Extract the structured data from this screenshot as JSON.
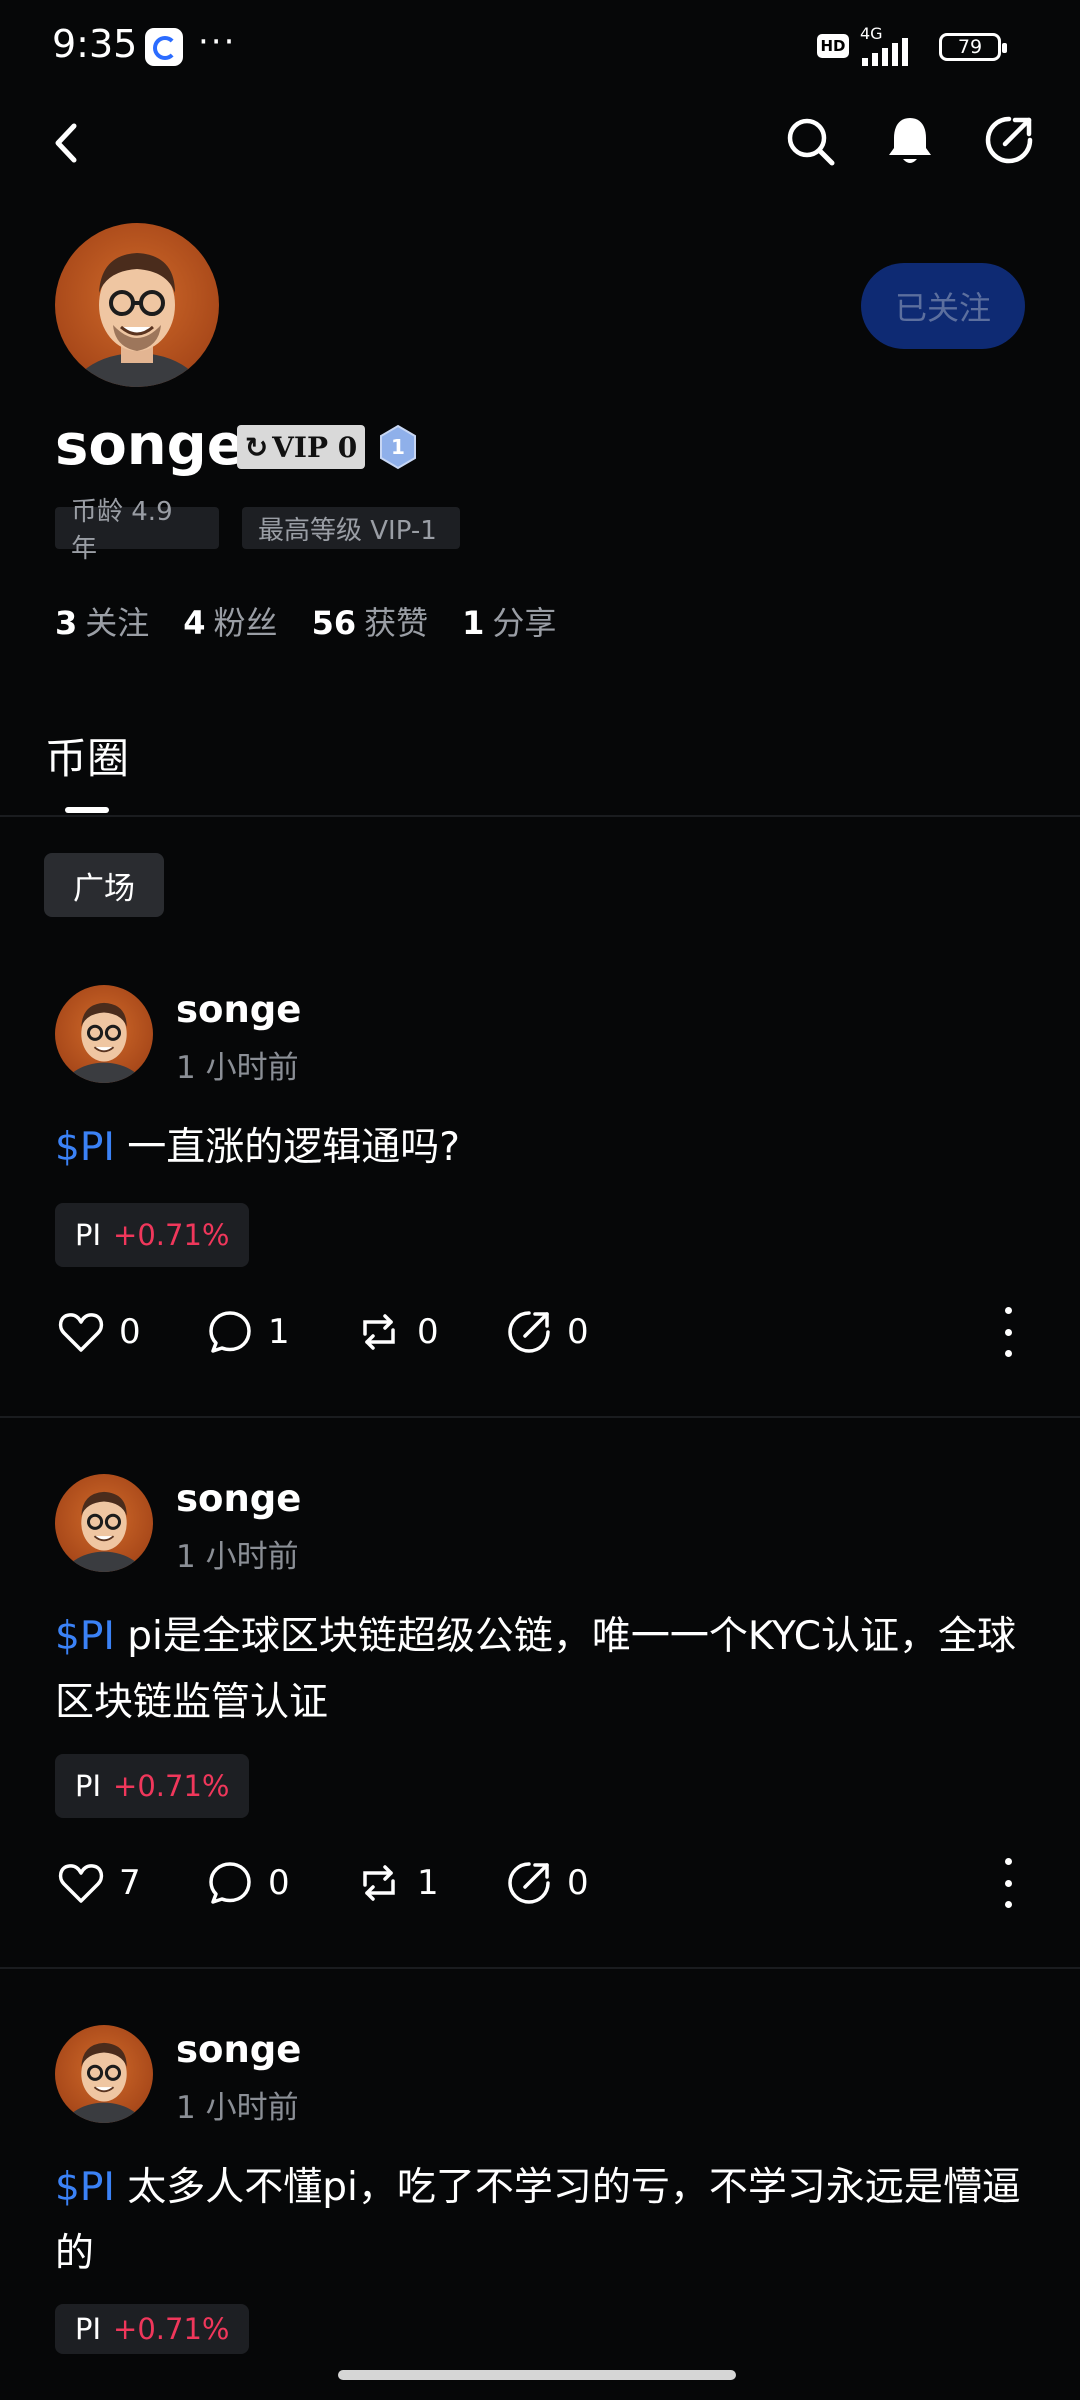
{
  "status": {
    "time": "9:35",
    "dots": "···",
    "hd": "HD",
    "network": "4G",
    "battery": "79"
  },
  "profile": {
    "username": "songe",
    "vip_label": "VIP 0",
    "level_badge": "1",
    "follow_button": "已关注",
    "tags": [
      "币龄 4.9 年",
      "最高等级 VIP-1"
    ],
    "stats": [
      {
        "num": "3",
        "label": "关注"
      },
      {
        "num": "4",
        "label": "粉丝"
      },
      {
        "num": "56",
        "label": "获赞"
      },
      {
        "num": "1",
        "label": "分享"
      }
    ]
  },
  "tab": {
    "label": "币圈"
  },
  "filter_chip": "广场",
  "posts": [
    {
      "author": "songe",
      "time": "1 小时前",
      "cashtag": "$PI",
      "text": " 一直涨的逻辑通吗?",
      "coin": "PI",
      "change": "+0.71%",
      "likes": "0",
      "comments": "1",
      "reposts": "0",
      "shares": "0"
    },
    {
      "author": "songe",
      "time": "1 小时前",
      "cashtag": "$PI",
      "text": " pi是全球区块链超级公链，唯一一个KYC认证，全球区块链监管认证",
      "coin": "PI",
      "change": "+0.71%",
      "likes": "7",
      "comments": "0",
      "reposts": "1",
      "shares": "0"
    },
    {
      "author": "songe",
      "time": "1 小时前",
      "cashtag": "$PI",
      "text": " 太多人不懂pi，吃了不学习的亏，不学习永远是懵逼的",
      "coin": "PI",
      "change": "+0.71%"
    }
  ],
  "colors": {
    "accent": "#3b82f6",
    "up": "#f0375b",
    "follow_bg": "#0e2a73",
    "background": "#060708"
  }
}
